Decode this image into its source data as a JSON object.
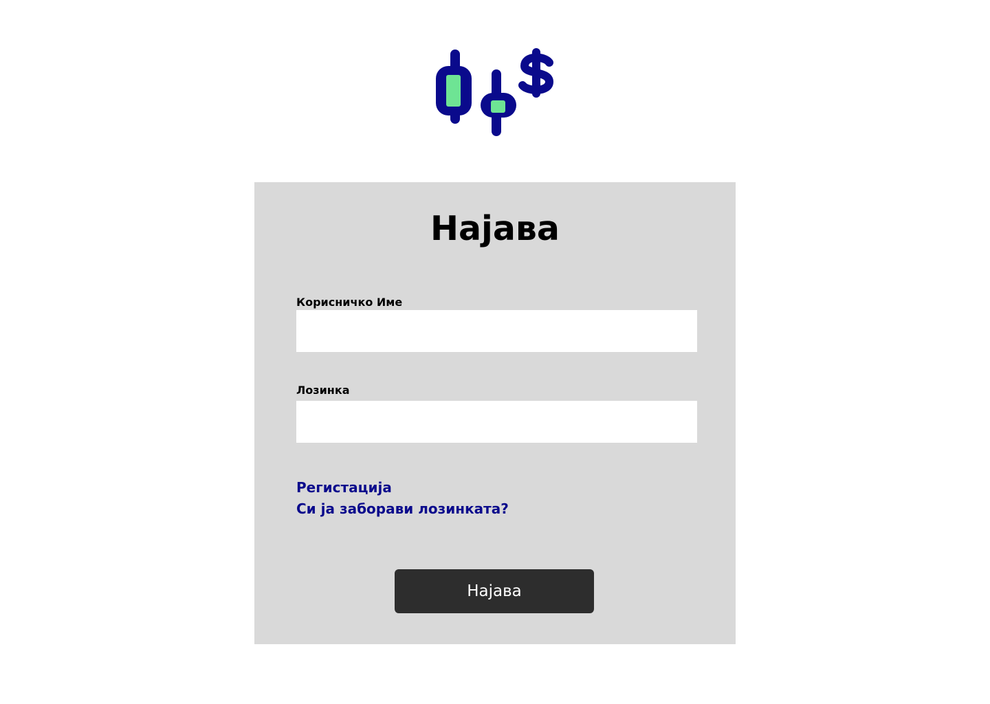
{
  "logo": {
    "icon": "candlestick-dollar-icon",
    "colors": {
      "primary": "#0a0a8c",
      "accent": "#6ee494"
    }
  },
  "login": {
    "title": "Најава",
    "username": {
      "label": "Корисничко Име",
      "value": "",
      "placeholder": ""
    },
    "password": {
      "label": "Лозинка",
      "value": "",
      "placeholder": ""
    },
    "links": {
      "register": "Регистација",
      "forgot_password": "Си ја заборави лозинката?"
    },
    "submit_label": "Најава"
  },
  "colors": {
    "page_background": "#ffffff",
    "card_background": "#d9d9d9",
    "link": "#0a0a8c",
    "button_background": "#2d2d2d",
    "button_text": "#ffffff"
  }
}
